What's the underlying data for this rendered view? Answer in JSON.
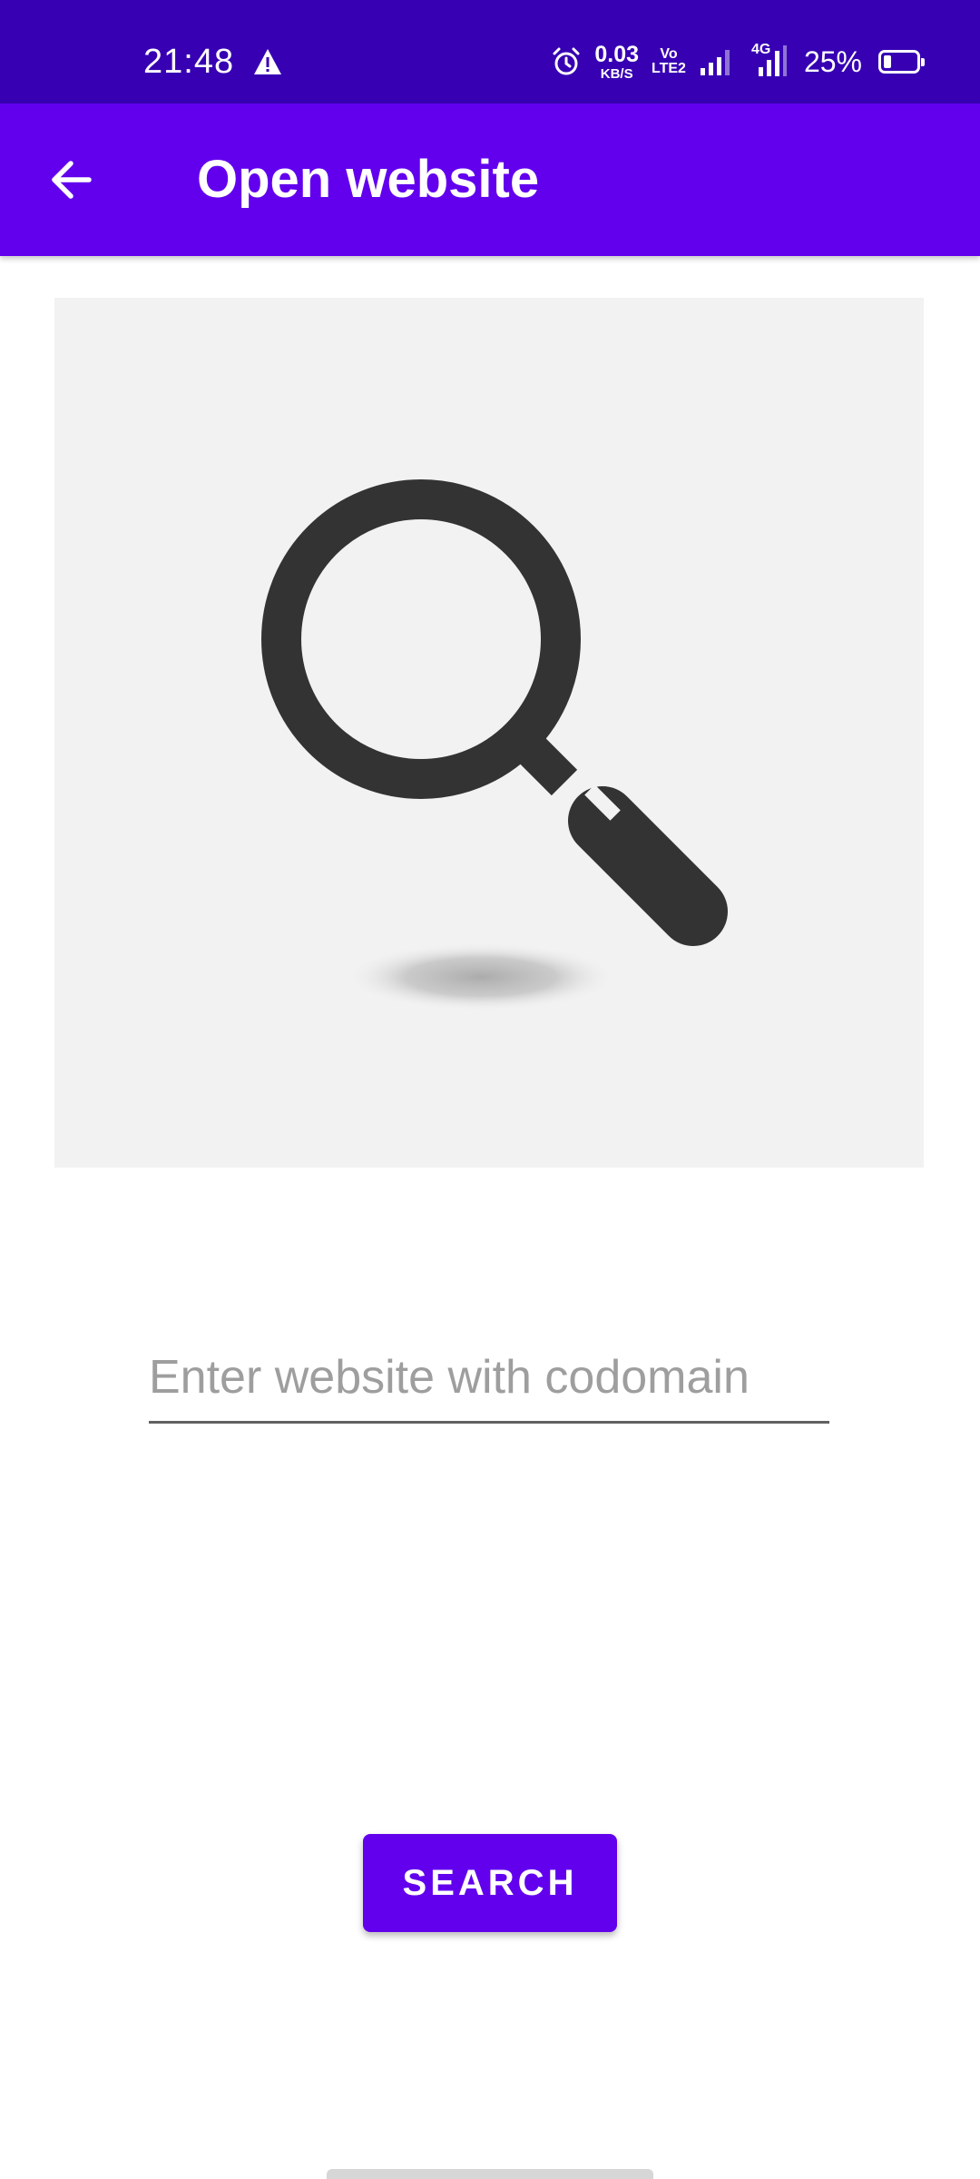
{
  "status_bar": {
    "time": "21:48",
    "net_speed_value": "0.03",
    "net_speed_unit": "KB/S",
    "volte_top": "Vo",
    "volte_bottom": "LTE2",
    "network_type": "4G",
    "battery_percent": "25%",
    "icons": [
      "warning-icon",
      "alarm-icon",
      "signal-icon",
      "battery-icon"
    ]
  },
  "app_bar": {
    "title": "Open website",
    "back_icon": "arrow-back-icon",
    "color": "#6200ee"
  },
  "hero": {
    "icon": "magnifier-icon"
  },
  "search_input": {
    "value": "",
    "placeholder": "Enter website with codomain"
  },
  "search_button": {
    "label": "SEARCH"
  },
  "colors": {
    "status_bar": "#3700b3",
    "primary": "#6200ee",
    "hero_background": "#f2f2f2",
    "icon_dark": "#333333"
  }
}
